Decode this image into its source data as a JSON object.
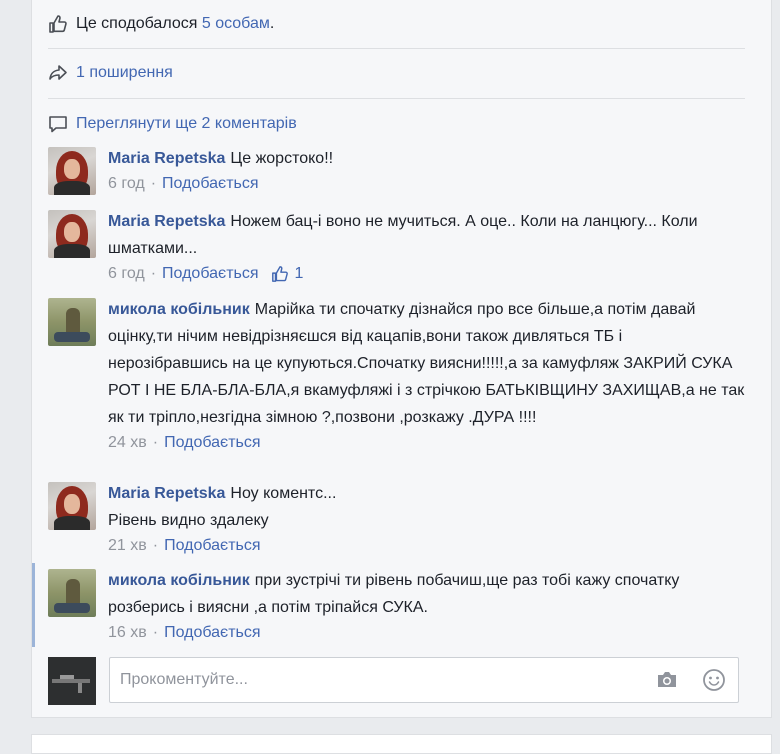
{
  "likes_bar": {
    "prefix": "Це сподобалося",
    "count_link": "5 особам",
    "suffix": "."
  },
  "shares": {
    "label": "1 поширення"
  },
  "view_more": {
    "label": "Переглянути ще 2 коментарів"
  },
  "comments": [
    {
      "author": "Maria Repetska",
      "text": "Це жорстоко!!",
      "time": "6 год",
      "like_label": "Подобається",
      "like_count": ""
    },
    {
      "author": "Maria Repetska",
      "text": "Ножем бац-і воно не мучиться. А оце.. Коли на ланцюгу... Коли шматками...",
      "time": "6 год",
      "like_label": "Подобається",
      "like_count": "1"
    },
    {
      "author": "микола кобільник",
      "text": "Марійка ти спочатку дізнайся про все більше,а потім давай оцінку,ти нічим невідрізняєшся від кацапів,вони також дивляться ТБ і нерозібравшись на це купуються.Спочатку виясни!!!!!,а за камуфляж ЗАКРИЙ СУКА РОТ І НЕ БЛА-БЛА-БЛА,я вкамуфляжі і з стрічкою БАТЬКІВЩИНУ ЗАХИЩАВ,а не так як ти тріпло,незгідна зімною ?,позвони ,розкажу .ДУРА !!!!",
      "time": "24 хв",
      "like_label": "Подобається",
      "like_count": ""
    },
    {
      "author": "Maria Repetska",
      "text": "Ноу коментс...",
      "text2": "Рівень видно здалеку",
      "time": "21 хв",
      "like_label": "Подобається",
      "like_count": ""
    },
    {
      "author": "микола кобільник",
      "text": "при зустрічі ти рівень побачиш,ще раз тобі кажу спочатку розберись і виясни ,а потім тріпайся СУКА.",
      "time": "16 хв",
      "like_label": "Подобається",
      "like_count": ""
    }
  ],
  "composer": {
    "placeholder": "Прокоментуйте..."
  },
  "colors": {
    "link": "#4267b2",
    "author": "#385898",
    "meta": "#90949c",
    "background": "#e9ebee"
  },
  "icons": [
    "thumbs-up-icon",
    "share-arrow-icon",
    "comment-bubble-icon",
    "camera-icon",
    "smiley-icon"
  ]
}
